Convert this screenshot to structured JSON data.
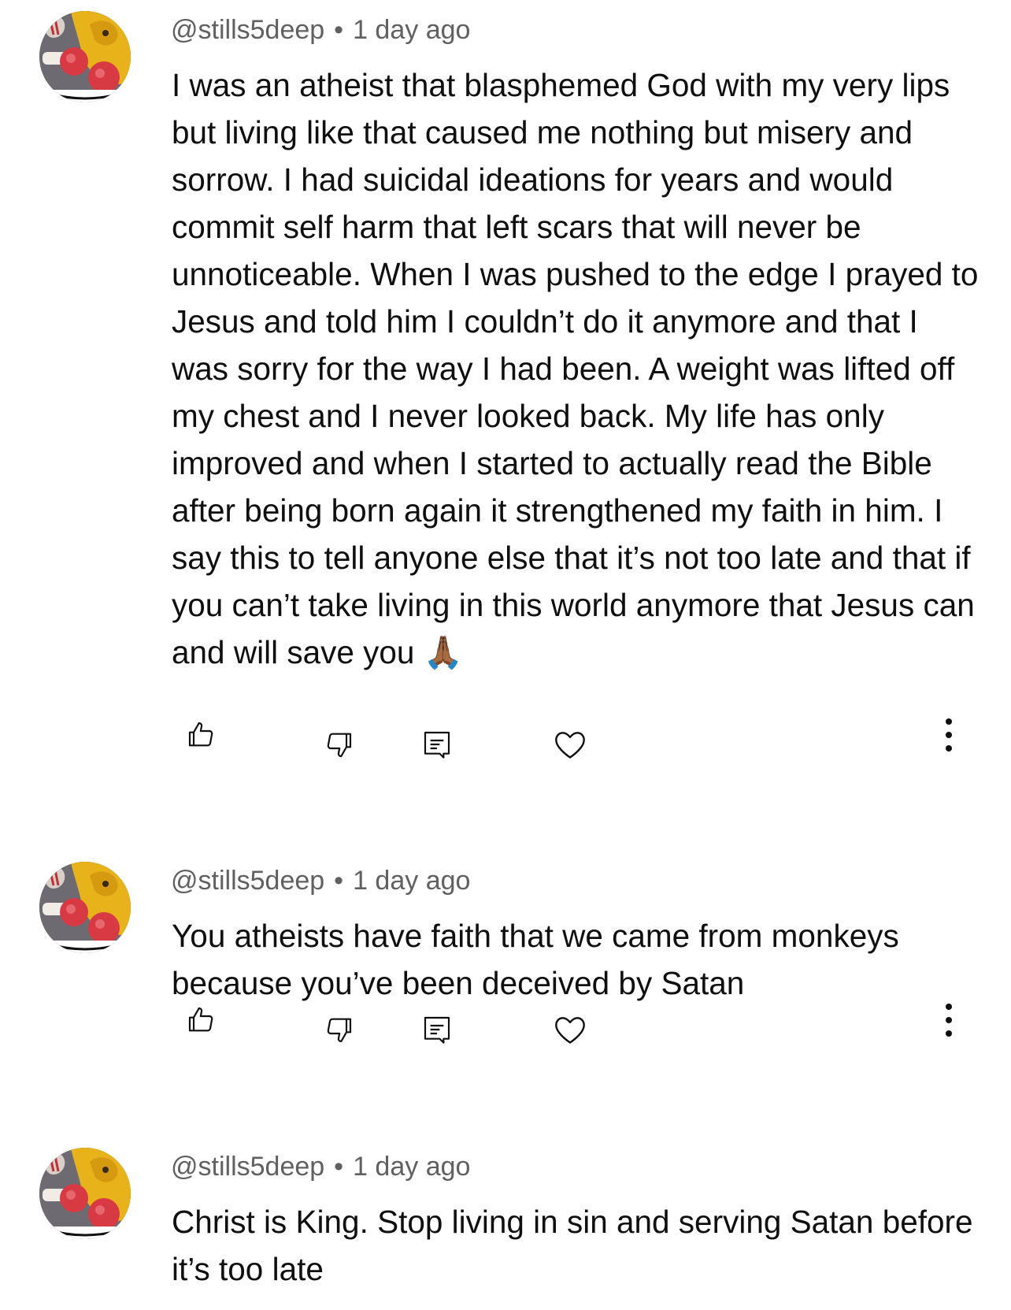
{
  "comments": [
    {
      "handle": "@stills5deep",
      "separator": "•",
      "time": "1 day ago",
      "text": "I was an atheist that blasphemed God with my very lips but living like that caused me nothing but misery and sorrow. I had suicidal ideations for years and would commit self harm that left scars that will never be unnoticeable.  When I was pushed to the edge I prayed to Jesus and told him I couldn’t do it anymore and that I was sorry for the way I had been.  A weight was lifted off my chest and I never looked back.  My life has only improved and when I started to actually read the Bible after being born again it strengthened my faith in him.  I say this to tell anyone else that it’s not too late and that if you can’t take living in this world anymore that Jesus can and will save you 🙏🏾"
    },
    {
      "handle": "@stills5deep",
      "separator": "•",
      "time": "1 day ago",
      "text": "You atheists have faith that we came from monkeys because you’ve been deceived by Satan"
    },
    {
      "handle": "@stills5deep",
      "separator": "•",
      "time": "1 day ago",
      "text": "Christ is King. Stop living in sin and serving Satan before it’s too late"
    }
  ],
  "icons": {
    "like": "thumbs-up-icon",
    "dislike": "thumbs-down-icon",
    "reply": "reply-comment-icon",
    "heart": "heart-icon",
    "more": "more-vertical-icon"
  },
  "colors": {
    "text": "#0f0f0f",
    "meta": "#606060",
    "icon": "#0f0f0f",
    "background": "#ffffff"
  }
}
